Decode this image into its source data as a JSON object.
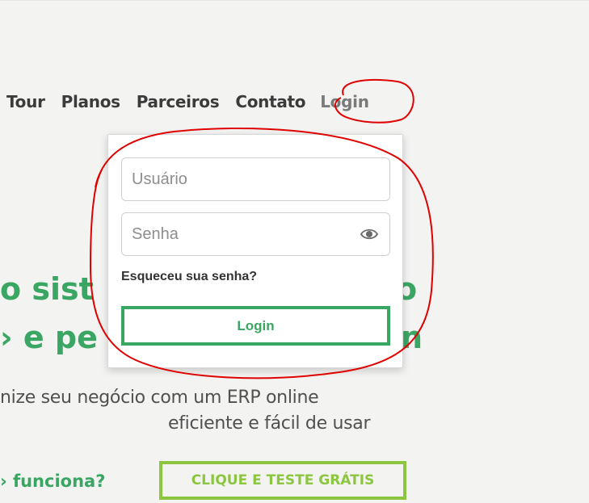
{
  "nav": {
    "items": [
      {
        "label": "Tour"
      },
      {
        "label": "Planos"
      },
      {
        "label": "Parceiros"
      },
      {
        "label": "Contato"
      },
      {
        "label": "Login"
      }
    ]
  },
  "hero": {
    "line1_visible": "o sist",
    "line1_tail": "o",
    "line2_visible": "› e pe",
    "line2_tail": "n",
    "subtitle_line1": "nize seu negócio com um ERP online",
    "subtitle_line2": "eficiente e fácil de usar",
    "how_label": "› funciona?",
    "cta_label": "CLIQUE E TESTE GRÁTIS"
  },
  "login_dropdown": {
    "username_placeholder": "Usuário",
    "password_placeholder": "Senha",
    "forgot_label": "Esqueceu sua senha?",
    "submit_label": "Login"
  },
  "colors": {
    "brand_green": "#3aa663",
    "cta_green": "#8cc53f",
    "annotation_red": "#e00000"
  }
}
